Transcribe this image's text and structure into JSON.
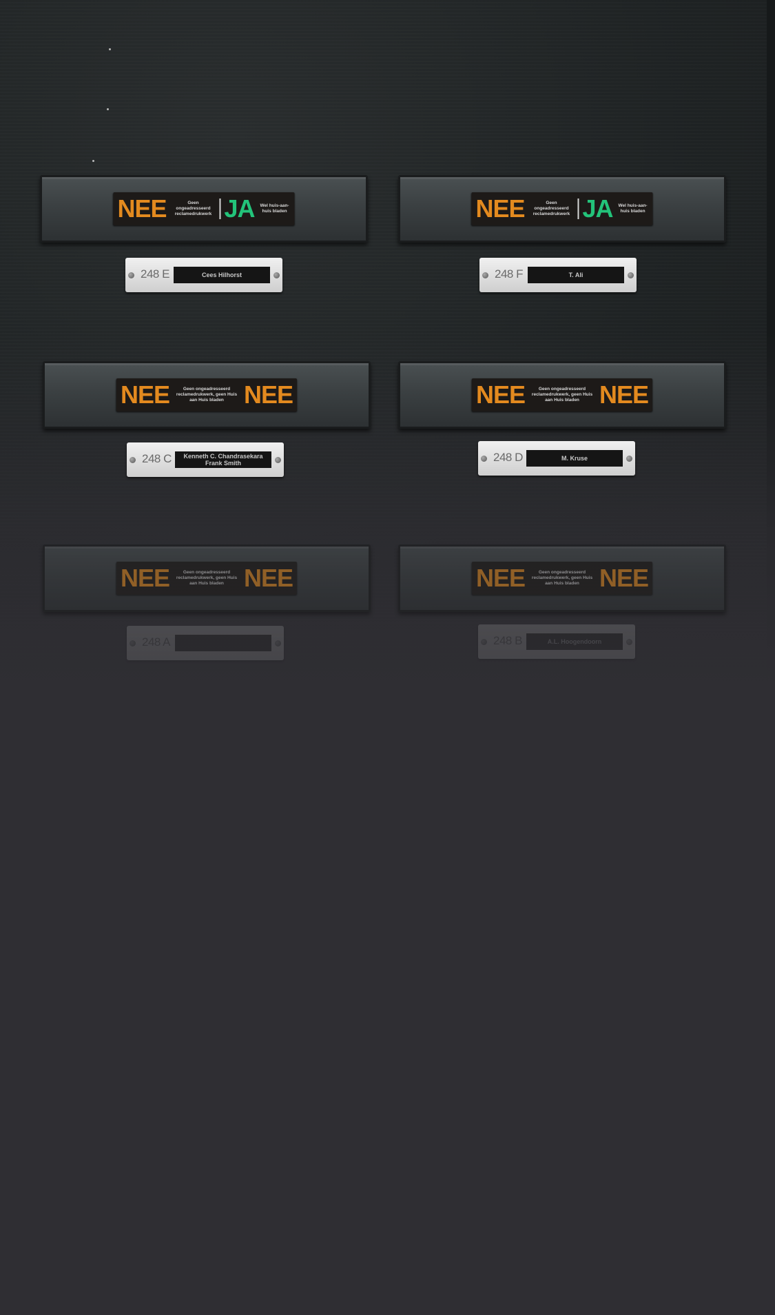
{
  "mailboxes": [
    {
      "sticker": {
        "left_big": "NEE",
        "left_small": "Geen ongeadresseerd reclamedrukwerk",
        "right_big": "JA",
        "right_small": "Wel huis-aan-huis bladen"
      },
      "plate": {
        "number": "248 E",
        "name": "Cees Hilhorst"
      }
    },
    {
      "sticker": {
        "left_big": "NEE",
        "left_small": "Geen ongeadresseerd reclamedrukwerk",
        "right_big": "JA",
        "right_small": "Wel huis-aan-huis bladen"
      },
      "plate": {
        "number": "248 F",
        "name": "T. Ali"
      }
    },
    {
      "sticker": {
        "left_big": "NEE",
        "left_small": "Geen ongeadresseerd reclamedrukwerk, geen Huis aan Huis bladen",
        "right_big": "NEE"
      },
      "plate": {
        "number": "248 C",
        "name": "Kenneth C. Chandrasekara Frank Smith"
      }
    },
    {
      "sticker": {
        "left_big": "NEE",
        "left_small": "Geen ongeadresseerd reclamedrukwerk, geen Huis aan Huis bladen",
        "right_big": "NEE"
      },
      "plate": {
        "number": "248 D",
        "name": "M. Kruse"
      }
    },
    {
      "sticker": {
        "left_big": "NEE",
        "left_small": "Geen ongeadresseerd reclamedrukwerk, geen Huis aan Huis bladen",
        "right_big": "NEE"
      },
      "plate": {
        "number": "248 A",
        "name": ""
      }
    },
    {
      "sticker": {
        "left_big": "NEE",
        "left_small": "Geen ongeadresseerd reclamedrukwerk, geen Huis aan Huis bladen",
        "right_big": "NEE"
      },
      "plate": {
        "number": "248 B",
        "name": "A.L. Hoogendoorn"
      }
    }
  ],
  "colors": {
    "nee": "#e38a1f",
    "ja": "#23c37a",
    "door": "#1f2324",
    "background": "#2f2e33"
  }
}
